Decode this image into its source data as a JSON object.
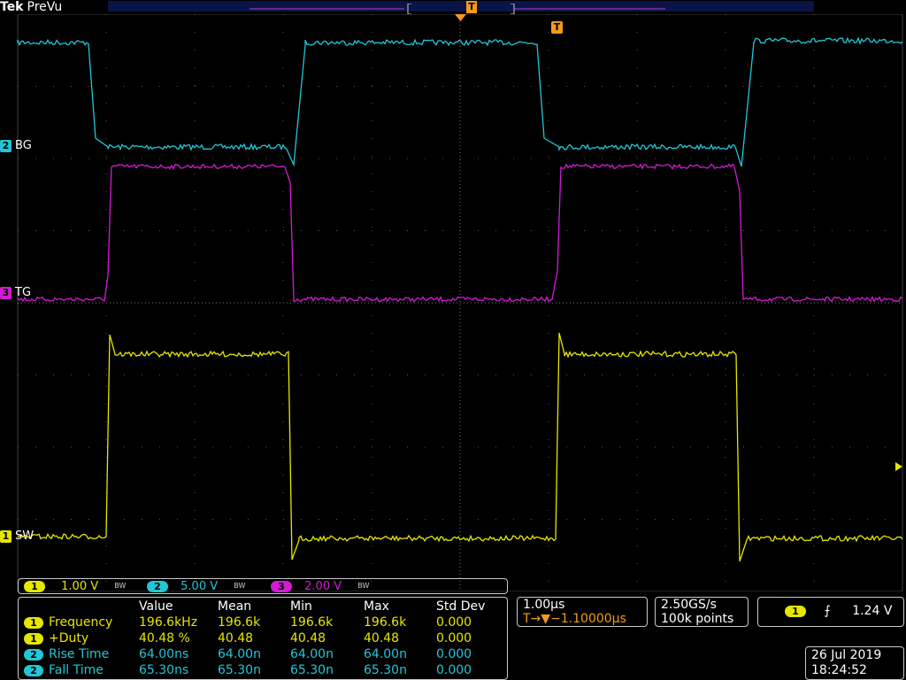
{
  "header": {
    "brand": "Tek",
    "mode": "PreVu"
  },
  "trigger_marker": "T",
  "channels": [
    {
      "id": "2",
      "name": "BG",
      "color": "#22c6d6"
    },
    {
      "id": "3",
      "name": "TG",
      "color": "#d31bd3"
    },
    {
      "id": "1",
      "name": "SW",
      "color": "#e6e600"
    }
  ],
  "status_bar": {
    "ch1": {
      "id": "1",
      "scale": "1.00 V",
      "bw": "BW",
      "color": "#e6e600"
    },
    "ch2": {
      "id": "2",
      "scale": "5.00 V",
      "bw": "BW",
      "color": "#22c6d6"
    },
    "ch3": {
      "id": "3",
      "scale": "2.00 V",
      "bw": "BW",
      "color": "#d31bd3"
    }
  },
  "measurements": {
    "headers": [
      "Value",
      "Mean",
      "Min",
      "Max",
      "Std Dev"
    ],
    "rows": [
      {
        "ch": "1",
        "color": "#e6e600",
        "name": "Frequency",
        "value": "196.6kHz",
        "mean": "196.6k",
        "min": "196.6k",
        "max": "196.6k",
        "std": "0.000"
      },
      {
        "ch": "1",
        "color": "#e6e600",
        "name": "+Duty",
        "value": "40.48 %",
        "mean": "40.48",
        "min": "40.48",
        "max": "40.48",
        "std": "0.000"
      },
      {
        "ch": "2",
        "color": "#22c6d6",
        "name": "Rise Time",
        "value": "64.00ns",
        "mean": "64.00n",
        "min": "64.00n",
        "max": "64.00n",
        "std": "0.000"
      },
      {
        "ch": "2",
        "color": "#22c6d6",
        "name": "Fall Time",
        "value": "65.30ns",
        "mean": "65.30n",
        "min": "65.30n",
        "max": "65.30n",
        "std": "0.000"
      }
    ]
  },
  "horizontal": {
    "scale": "1.00µs",
    "trigger_pos": "T→▼−1.10000µs"
  },
  "acquisition": {
    "rate": "2.50GS/s",
    "points": "100k points"
  },
  "trigger": {
    "ch": "1",
    "slope": "⨍",
    "level": "1.24 V",
    "color": "#e6e600"
  },
  "datetime": {
    "date": "26 Jul  2019",
    "time": "18:24:52"
  }
}
